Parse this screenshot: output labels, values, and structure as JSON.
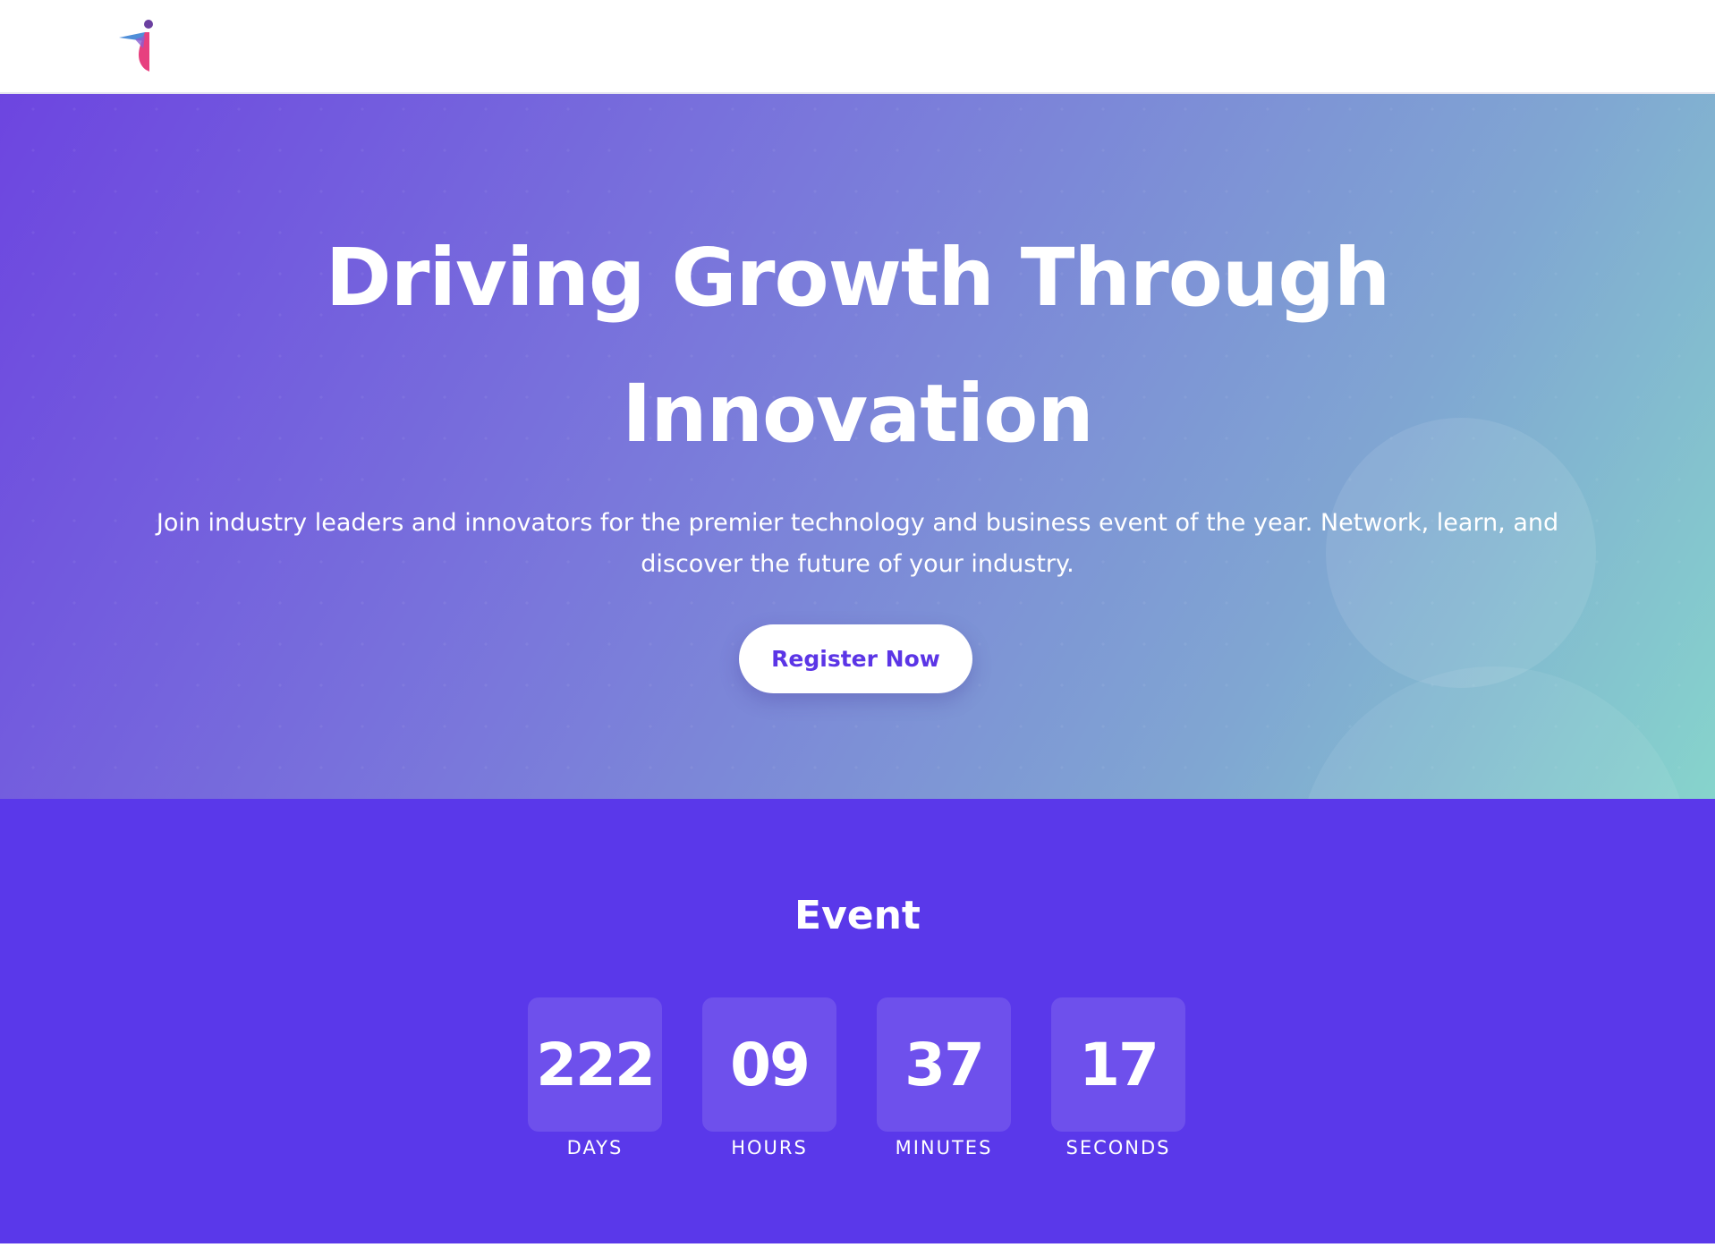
{
  "header": {
    "logo": "brand-logo",
    "colors": {
      "logo_primary": "#e7407f",
      "logo_secondary": "#4f8ed8",
      "logo_dot": "#6b3fa0"
    }
  },
  "hero": {
    "title_line1": "Driving Growth Through",
    "title_line2": "Innovation",
    "subtitle": "Join industry leaders and innovators for the premier technology and business event of the year. Network, learn, and discover the future of your industry.",
    "cta_label": "Register Now",
    "colors": {
      "gradient_start": "#6d45e0",
      "gradient_end": "#86d4cc",
      "cta_text": "#5b35e6"
    }
  },
  "event": {
    "title": "Event",
    "background": "#5a38ea",
    "countdown": [
      {
        "value": "222",
        "label": "DAYS"
      },
      {
        "value": "09",
        "label": "HOURS"
      },
      {
        "value": "37",
        "label": "MINUTES"
      },
      {
        "value": "17",
        "label": "SECONDS"
      }
    ]
  }
}
